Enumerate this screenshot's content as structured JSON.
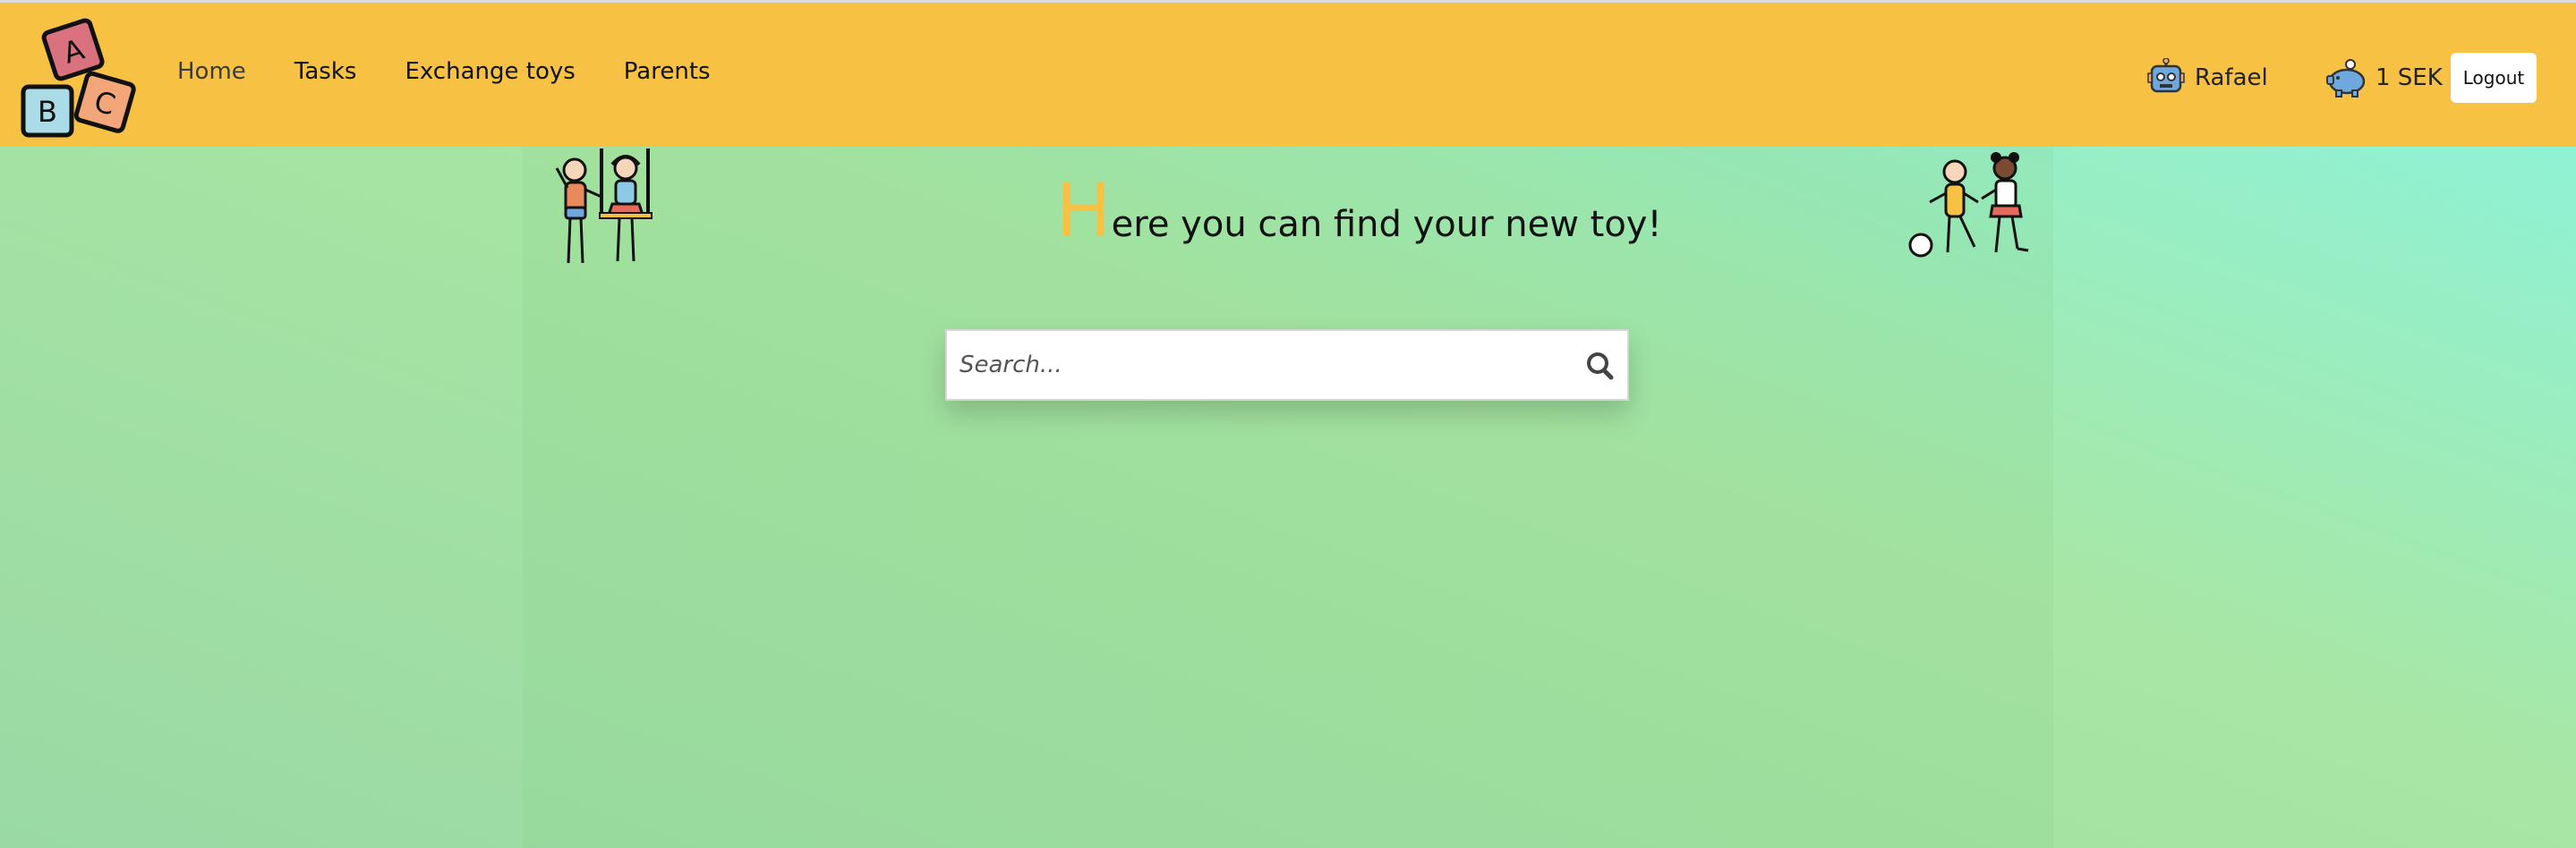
{
  "nav": {
    "links": [
      {
        "label": "Home"
      },
      {
        "label": "Tasks"
      },
      {
        "label": "Exchange toys"
      },
      {
        "label": "Parents"
      }
    ],
    "logo_letters": {
      "a": "A",
      "b": "B",
      "c": "C"
    },
    "user": {
      "name": "Rafael",
      "icon": "robot-icon"
    },
    "balance": {
      "amount": "1 SEK",
      "icon": "piggy-bank-icon"
    },
    "logout_label": "Logout"
  },
  "main": {
    "heading_first": "H",
    "heading_rest": "ere you can find your new toy!",
    "search": {
      "placeholder": "Search...",
      "value": "",
      "icon": "search-icon"
    }
  },
  "colors": {
    "navbar": "#f7c244",
    "accent": "#f7c244",
    "background_top": "#8af5e0",
    "background_mid": "#a8e6a3"
  }
}
